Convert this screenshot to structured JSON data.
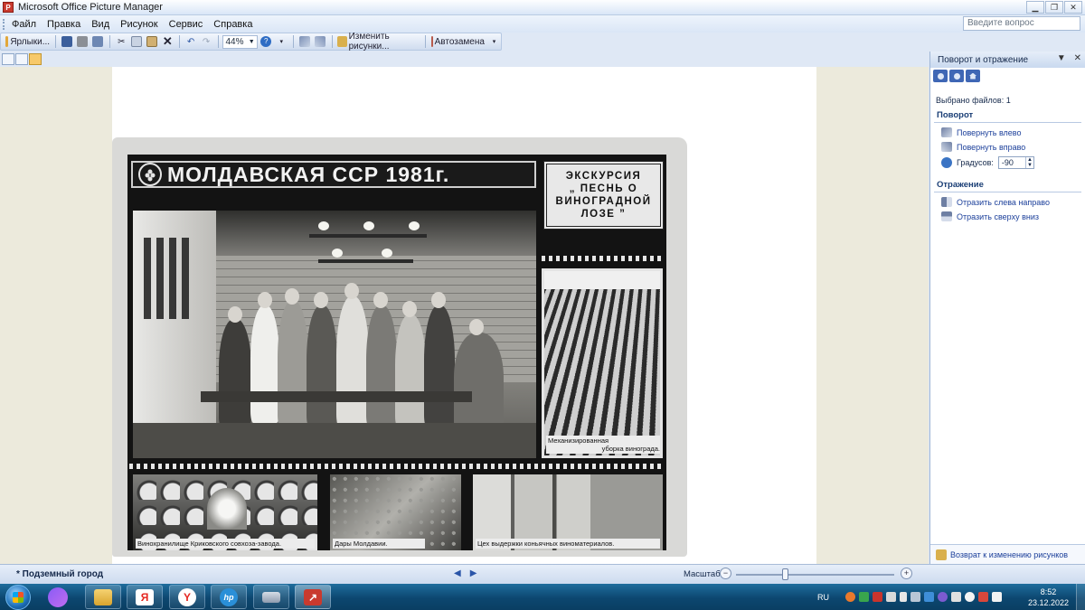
{
  "window": {
    "title": "Microsoft Office Picture Manager",
    "app_icon": "picture-manager-icon",
    "controls": [
      "minimize-icon",
      "restore-icon",
      "close-icon"
    ]
  },
  "menu": {
    "items": [
      "Файл",
      "Правка",
      "Вид",
      "Рисунок",
      "Сервис",
      "Справка"
    ],
    "help_placeholder": "Введите вопрос"
  },
  "toolbar": {
    "shortcuts_label": "Ярлыки...",
    "zoom_value": "44%",
    "edit_pictures_label": "Изменить рисунки...",
    "autocorrect_label": "Автозамена"
  },
  "photo": {
    "title": "МОЛДАВСКАЯ ССР 1981г.",
    "tour_label": "ЭКСКУРСИЯ\n„ ПЕСНЬ О\nВИНОГРАДНОЙ\nЛОЗЕ ”",
    "vineyard_caption_1": "Механизированная",
    "vineyard_caption_2": "уборка винограда.",
    "strip_captions": [
      "Винохранилище Криковского совхоза-завода.",
      "Дары Молдавии.",
      "Цех выдержки коньячных виноматериалов."
    ]
  },
  "taskpane": {
    "title": "Поворот и отражение",
    "nav_icons": [
      "back-icon",
      "forward-icon",
      "home-icon"
    ],
    "files_selected": "Выбрано файлов: 1",
    "rotation_section": "Поворот",
    "rotate_left": "Повернуть влево",
    "rotate_right": "Повернуть вправо",
    "degrees_label": "Градусов:",
    "degrees_value": "-90",
    "flip_section": "Отражение",
    "flip_horizontal": "Отразить слева направо",
    "flip_vertical": "Отразить сверху вниз",
    "back_link": "Возврат к изменению рисунков"
  },
  "status": {
    "file_name": "* Подземный город",
    "zoom_label": "Масштаб:"
  },
  "taskbar": {
    "language": "RU",
    "time": "8:52",
    "date": "23.12.2022",
    "apps": [
      "explorer-icon",
      "yandex-icon",
      "yandex-browser-icon",
      "hp-icon",
      "scanner-icon",
      "picture-manager-icon"
    ]
  },
  "colors": {
    "chrome_blue": "#dfe8f5",
    "link_blue": "#1b3f9a",
    "workspace_bg": "#eceadc",
    "taskbar": "#0c4770"
  }
}
